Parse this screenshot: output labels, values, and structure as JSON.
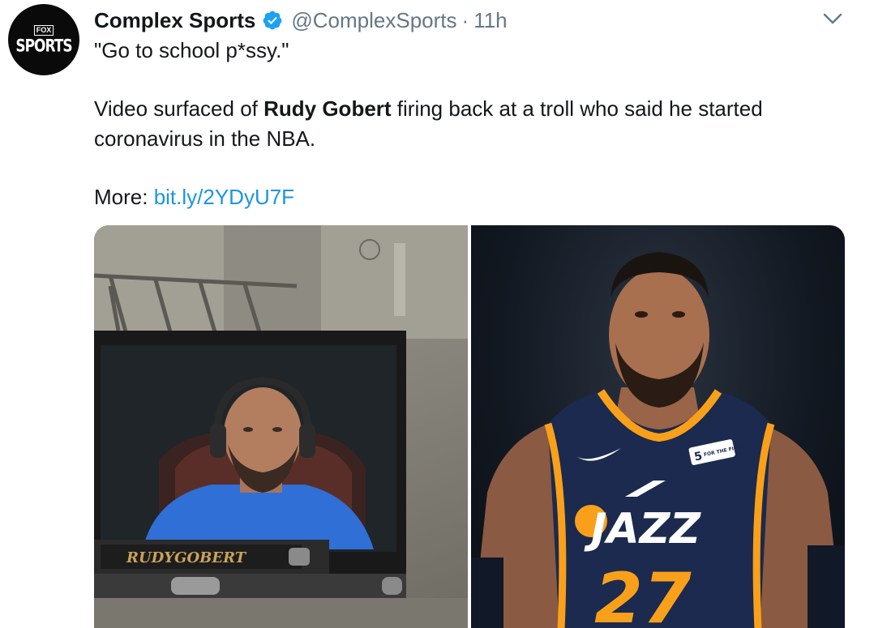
{
  "tweet": {
    "avatar": {
      "small_text": "FOX",
      "big_text": "SPORTS"
    },
    "display_name": "Complex Sports",
    "handle": "@ComplexSports",
    "separator": "·",
    "time": "11h",
    "line1": "\"Go to school p*ssy.\"",
    "line2_prefix": "Video surfaced of ",
    "line2_bold": "Rudy Gobert",
    "line2_suffix": " firing back at a troll who said he started",
    "line3": "coronavirus in the NBA.",
    "more_label": "More: ",
    "more_link": "bit.ly/2YDyU7F"
  },
  "media": {
    "left_image_caption": "RUDYGOBERT",
    "right_jersey_text": "JAZZ",
    "right_jersey_number": "27",
    "right_patch_number": "5",
    "right_patch_text": "FOR THE FIGHT"
  },
  "colors": {
    "link": "#1b95e0",
    "verified": "#1da1f2",
    "muted": "#657786",
    "jersey_navy": "#1b2a4e",
    "jersey_gold": "#f9a01b"
  },
  "icons": [
    "verified-badge-icon",
    "chevron-down-icon"
  ]
}
